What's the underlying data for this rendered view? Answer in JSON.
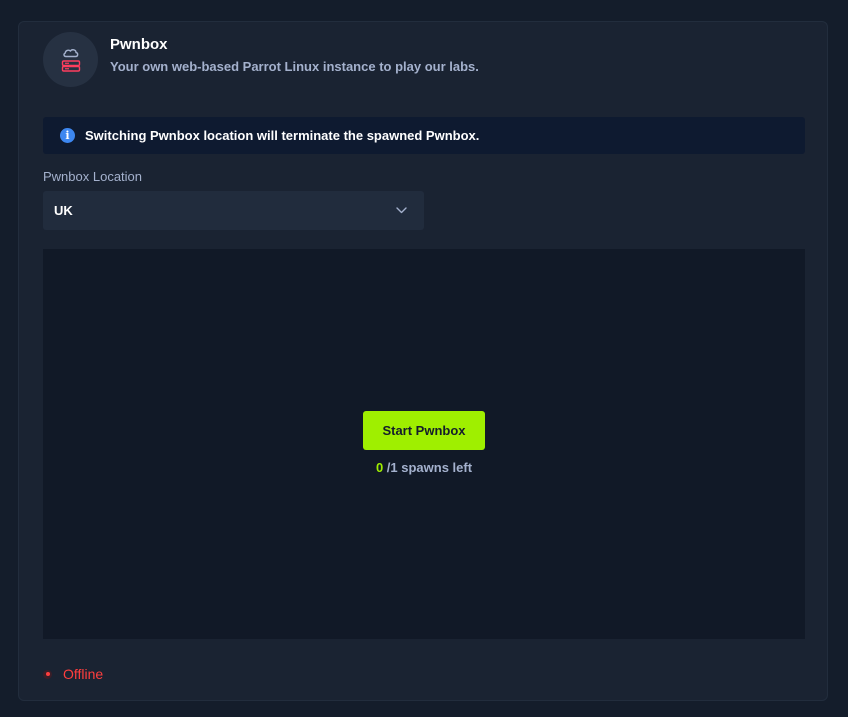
{
  "header": {
    "title": "Pwnbox",
    "subtitle": "Your own web-based Parrot Linux instance to play our labs.",
    "icon": "cloud-server-icon"
  },
  "info_banner": {
    "icon": "info-icon",
    "text": "Switching Pwnbox location will terminate the spawned Pwnbox."
  },
  "location": {
    "label": "Pwnbox Location",
    "selected": "UK"
  },
  "start": {
    "button_label": "Start Pwnbox",
    "spawns_used": "0",
    "spawns_suffix": "/1 spawns left"
  },
  "status": {
    "text": "Offline",
    "color": "#ff3e3e"
  },
  "colors": {
    "accent": "#9fef00",
    "info": "#3d87f0",
    "background": "#141d2b",
    "card": "#1a2332"
  }
}
